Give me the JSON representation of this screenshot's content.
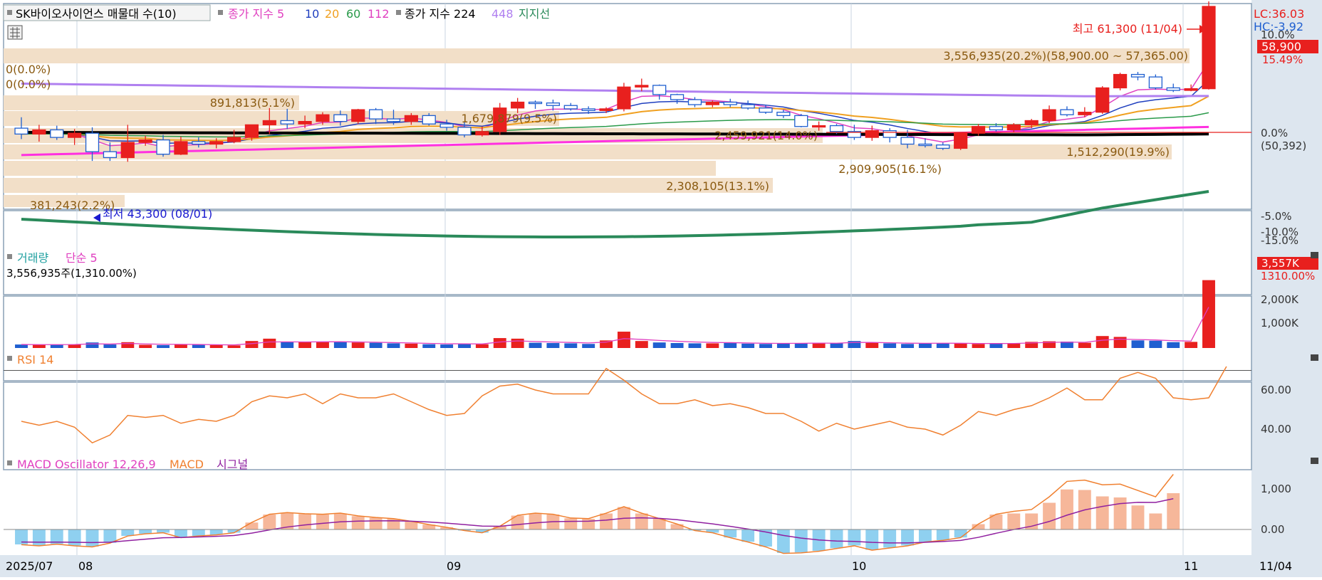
{
  "colors": {
    "up": "#e8201e",
    "down": "#1f5fd0",
    "ma5": "#e040c0",
    "ma10": "#1f3fbf",
    "ma20": "#f0a020",
    "ma60": "#2a9a4a",
    "ma112": "#b080f0",
    "ma224": "#000000",
    "ma448": "#b080f0",
    "support": "#2a8a5a",
    "volband": "#f2dfc8",
    "rsi": "#f08030",
    "macd": "#f08030",
    "signal": "#9020a0",
    "osc_pos": "#f6b79a",
    "osc_neg": "#8fd0f0",
    "axis_bg": "#dde6ef"
  },
  "header": {
    "title": "SK바이오사이언스 매물대 수(10)",
    "ma_label": "종가 지수 5",
    "ma10": "10",
    "ma20": "20",
    "ma60": "60",
    "ma112": "112",
    "long_label": "종가 지수 224",
    "long448": "448",
    "support_label": "지지선"
  },
  "right_axis": {
    "lc": "LC:36.03",
    "hc": "HC:-3.92",
    "price_box": "58,900",
    "price_pct": "15.49%",
    "ticks": [
      "10.0%",
      "0.0%",
      "(50,392)",
      "-5.0%",
      "-10.0%",
      "-15.0%"
    ]
  },
  "annotations": {
    "high": "최고 61,300 (11/04)",
    "low": "최저 43,300 (08/01)",
    "top_left_1": "0(0.0%)",
    "top_left_2": "0(0.0%)",
    "band_top": "3,556,935(20.2%)(58,900.00 ~ 57,365.00)",
    "band_2": "891,813(5.1%)",
    "band_3": "1,679,879(9.5%)",
    "band_4": "2,459,921(14.0%)",
    "band_5": "1,512,290(19.9%)",
    "band_6": "2,909,905(16.1%)",
    "band_7": "2,308,105(13.1%)",
    "band_8": "381,243(2.2%)"
  },
  "volume_panel": {
    "title1": "거래량",
    "title2": "단순 5",
    "info": "3,556,935주(1,310.00%)",
    "box": "3,557K",
    "box_pct": "1310.00%",
    "ticks": [
      "2,000K",
      "1,000K"
    ]
  },
  "rsi_panel": {
    "title": "RSI 14",
    "ticks": [
      "60.00",
      "40.00"
    ]
  },
  "macd_panel": {
    "title1": "MACD Oscillator 12,26,9",
    "title2": "MACD",
    "title3": "시그널",
    "ticks": [
      "1,000",
      "0.00"
    ]
  },
  "x_axis": {
    "labels": [
      "2025/07",
      "08",
      "09",
      "10",
      "11"
    ],
    "end_label": "11/04"
  },
  "chart_data": [
    {
      "type": "candlestick",
      "title": "SK바이오사이언스 매물대 수(10)",
      "candles": [
        {
          "o": 0.5,
          "h": 1.8,
          "l": -0.8,
          "c": -0.2
        },
        {
          "o": -0.2,
          "h": 0.9,
          "l": -1.1,
          "c": 0.3
        },
        {
          "o": 0.3,
          "h": 0.8,
          "l": -0.9,
          "c": -0.6
        },
        {
          "o": -0.6,
          "h": 0.4,
          "l": -1.5,
          "c": -0.1
        },
        {
          "o": -0.1,
          "h": 0.6,
          "l": -3.4,
          "c": -2.3
        },
        {
          "o": -2.3,
          "h": -1.2,
          "l": -3.4,
          "c": -3.0
        },
        {
          "o": -3.0,
          "h": 0.9,
          "l": -3.5,
          "c": -1.2
        },
        {
          "o": -1.2,
          "h": -0.4,
          "l": -1.6,
          "c": -0.9
        },
        {
          "o": -0.9,
          "h": -0.3,
          "l": -2.9,
          "c": -2.6
        },
        {
          "o": -2.6,
          "h": -0.5,
          "l": -2.7,
          "c": -1.1
        },
        {
          "o": -1.1,
          "h": -0.6,
          "l": -1.8,
          "c": -1.4
        },
        {
          "o": -1.4,
          "h": -0.7,
          "l": -1.9,
          "c": -1.1
        },
        {
          "o": -1.1,
          "h": 0.3,
          "l": -1.3,
          "c": -0.6
        },
        {
          "o": -0.6,
          "h": 0.9,
          "l": -1.0,
          "c": 0.9
        },
        {
          "o": 0.9,
          "h": 2.9,
          "l": -0.2,
          "c": 1.4
        },
        {
          "o": 1.4,
          "h": 2.8,
          "l": 0.4,
          "c": 1.0
        },
        {
          "o": 1.0,
          "h": 2.0,
          "l": 0.5,
          "c": 1.3
        },
        {
          "o": 1.3,
          "h": 2.4,
          "l": 0.9,
          "c": 2.1
        },
        {
          "o": 2.1,
          "h": 2.6,
          "l": 0.8,
          "c": 1.3
        },
        {
          "o": 1.3,
          "h": 2.8,
          "l": 1.0,
          "c": 2.7
        },
        {
          "o": 2.7,
          "h": 2.9,
          "l": 1.0,
          "c": 1.6
        },
        {
          "o": 1.6,
          "h": 2.7,
          "l": 0.9,
          "c": 1.3
        },
        {
          "o": 1.3,
          "h": 2.3,
          "l": 0.9,
          "c": 2.0
        },
        {
          "o": 2.0,
          "h": 2.3,
          "l": 0.8,
          "c": 1.0
        },
        {
          "o": 1.0,
          "h": 1.5,
          "l": 0.2,
          "c": 0.6
        },
        {
          "o": 0.6,
          "h": 1.2,
          "l": -0.6,
          "c": -0.3
        },
        {
          "o": -0.3,
          "h": 0.7,
          "l": -0.5,
          "c": 0.1
        },
        {
          "o": 0.1,
          "h": 3.5,
          "l": -0.3,
          "c": 2.9
        },
        {
          "o": 2.9,
          "h": 4.1,
          "l": 2.3,
          "c": 3.6
        },
        {
          "o": 3.6,
          "h": 3.8,
          "l": 2.8,
          "c": 3.5
        },
        {
          "o": 3.5,
          "h": 3.9,
          "l": 2.6,
          "c": 3.2
        },
        {
          "o": 3.2,
          "h": 3.5,
          "l": 2.6,
          "c": 2.8
        },
        {
          "o": 2.8,
          "h": 3.1,
          "l": 2.2,
          "c": 2.6
        },
        {
          "o": 2.6,
          "h": 3.0,
          "l": 2.3,
          "c": 2.8
        },
        {
          "o": 2.8,
          "h": 5.9,
          "l": 2.5,
          "c": 5.4
        },
        {
          "o": 5.4,
          "h": 6.4,
          "l": 4.9,
          "c": 5.6
        },
        {
          "o": 5.6,
          "h": 5.7,
          "l": 3.9,
          "c": 4.5
        },
        {
          "o": 4.5,
          "h": 4.6,
          "l": 3.4,
          "c": 3.9
        },
        {
          "o": 3.9,
          "h": 4.2,
          "l": 3.0,
          "c": 3.3
        },
        {
          "o": 3.3,
          "h": 3.8,
          "l": 3.0,
          "c": 3.6
        },
        {
          "o": 3.6,
          "h": 4.0,
          "l": 3.0,
          "c": 3.3
        },
        {
          "o": 3.3,
          "h": 3.8,
          "l": 2.7,
          "c": 2.9
        },
        {
          "o": 2.9,
          "h": 3.2,
          "l": 2.2,
          "c": 2.4
        },
        {
          "o": 2.4,
          "h": 2.7,
          "l": 1.7,
          "c": 2.0
        },
        {
          "o": 2.0,
          "h": 2.2,
          "l": 0.6,
          "c": 0.7
        },
        {
          "o": 0.7,
          "h": 1.3,
          "l": 0.2,
          "c": 0.8
        },
        {
          "o": 0.8,
          "h": 1.0,
          "l": -0.2,
          "c": 0.1
        },
        {
          "o": 0.1,
          "h": 0.9,
          "l": -0.9,
          "c": -0.6
        },
        {
          "o": -0.6,
          "h": 0.8,
          "l": -1.0,
          "c": 0.2
        },
        {
          "o": 0.2,
          "h": 0.5,
          "l": -1.2,
          "c": -0.6
        },
        {
          "o": -0.6,
          "h": 0.3,
          "l": -1.9,
          "c": -1.4
        },
        {
          "o": -1.4,
          "h": -0.7,
          "l": -1.8,
          "c": -1.5
        },
        {
          "o": -1.5,
          "h": -1.2,
          "l": -2.1,
          "c": -1.9
        },
        {
          "o": -1.9,
          "h": -0.4,
          "l": -2.1,
          "c": -0.1
        },
        {
          "o": -0.1,
          "h": 1.0,
          "l": -0.4,
          "c": 0.7
        },
        {
          "o": 0.7,
          "h": 1.1,
          "l": 0.1,
          "c": 0.3
        },
        {
          "o": 0.3,
          "h": 1.1,
          "l": 0.0,
          "c": 0.9
        },
        {
          "o": 0.9,
          "h": 1.6,
          "l": 0.5,
          "c": 1.4
        },
        {
          "o": 1.4,
          "h": 3.2,
          "l": 1.1,
          "c": 2.7
        },
        {
          "o": 2.7,
          "h": 3.1,
          "l": 1.9,
          "c": 2.1
        },
        {
          "o": 2.1,
          "h": 3.0,
          "l": 1.8,
          "c": 2.4
        },
        {
          "o": 2.4,
          "h": 5.5,
          "l": 2.2,
          "c": 5.3
        },
        {
          "o": 5.3,
          "h": 7.1,
          "l": 5.0,
          "c": 6.9
        },
        {
          "o": 6.9,
          "h": 7.2,
          "l": 6.2,
          "c": 6.6
        },
        {
          "o": 6.6,
          "h": 6.9,
          "l": 5.1,
          "c": 5.3
        },
        {
          "o": 5.3,
          "h": 5.8,
          "l": 4.8,
          "c": 5.0
        },
        {
          "o": 5.0,
          "h": 5.7,
          "l": 4.9,
          "c": 5.2
        },
        {
          "o": 5.2,
          "h": 15.6,
          "l": 5.1,
          "c": 15.0
        }
      ]
    },
    {
      "type": "bar",
      "title": "거래량",
      "values": [
        60,
        55,
        58,
        62,
        95,
        60,
        100,
        55,
        50,
        60,
        55,
        50,
        45,
        120,
        160,
        110,
        100,
        110,
        110,
        95,
        90,
        80,
        75,
        65,
        60,
        70,
        65,
        170,
        160,
        90,
        85,
        80,
        70,
        130,
        280,
        120,
        95,
        85,
        80,
        80,
        85,
        75,
        70,
        75,
        85,
        90,
        80,
        120,
        95,
        80,
        70,
        75,
        85,
        80,
        70,
        75,
        80,
        105,
        115,
        110,
        90,
        205,
        190,
        130,
        125,
        100,
        105,
        1310
      ]
    },
    {
      "type": "line",
      "title": "RSI 14",
      "values": [
        44,
        42,
        44,
        41,
        33,
        37,
        47,
        46,
        47,
        43,
        45,
        44,
        47,
        54,
        57,
        56,
        58,
        53,
        58,
        56,
        56,
        58,
        54,
        50,
        47,
        48,
        57,
        62,
        63,
        60,
        58,
        58,
        58,
        71,
        65,
        58,
        53,
        53,
        55,
        52,
        53,
        51,
        48,
        48,
        44,
        39,
        43,
        40,
        42,
        44,
        41,
        40,
        37,
        42,
        49,
        47,
        50,
        52,
        56,
        61,
        55,
        55,
        66,
        69,
        66,
        56,
        55,
        56,
        72
      ]
    },
    {
      "type": "bar",
      "title": "MACD Oscillator 12,26,9",
      "values": [
        -280,
        -300,
        -270,
        -300,
        -320,
        -250,
        -120,
        -80,
        -60,
        -150,
        -120,
        -100,
        -60,
        130,
        280,
        310,
        290,
        280,
        300,
        250,
        220,
        200,
        150,
        90,
        40,
        -20,
        -60,
        60,
        260,
        300,
        280,
        210,
        200,
        300,
        420,
        300,
        200,
        100,
        -20,
        -60,
        -150,
        -230,
        -320,
        -440,
        -430,
        -400,
        -350,
        -300,
        -380,
        -340,
        -300,
        -230,
        -200,
        -150,
        100,
        280,
        300,
        300,
        500,
        750,
        740,
        620,
        600,
        450,
        300,
        680
      ]
    }
  ]
}
